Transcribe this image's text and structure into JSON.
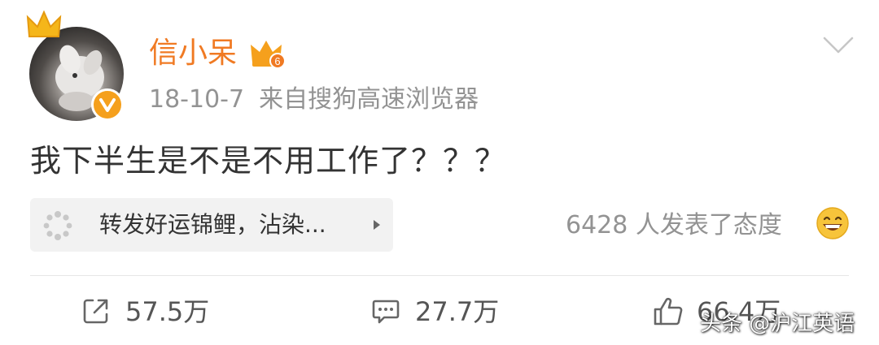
{
  "post": {
    "user": {
      "name": "信小呆",
      "avatar_icon": "rabbit-avatar",
      "verified_icon": "verified-v-icon",
      "vip_icon": "vip-crown-icon",
      "vip_level": "6"
    },
    "meta": {
      "date": "18-10-7",
      "source": "来自搜狗高速浏览器"
    },
    "text": "我下半生是不是不用工作了？？？",
    "repost_card": {
      "icon": "spinner-icon",
      "label": "转发好运锦鲤，沾染..."
    },
    "attitude": {
      "text": "6428 人发表了态度",
      "icon": "grinning-face-icon"
    },
    "actions": {
      "repost_count": "57.5万",
      "comment_count": "27.7万",
      "like_count": "66.4万"
    }
  },
  "watermark": "头条 @沪江英语",
  "colors": {
    "username": "#f07a23",
    "secondary_text": "#939393",
    "verified_badge": "#f5a01d"
  }
}
